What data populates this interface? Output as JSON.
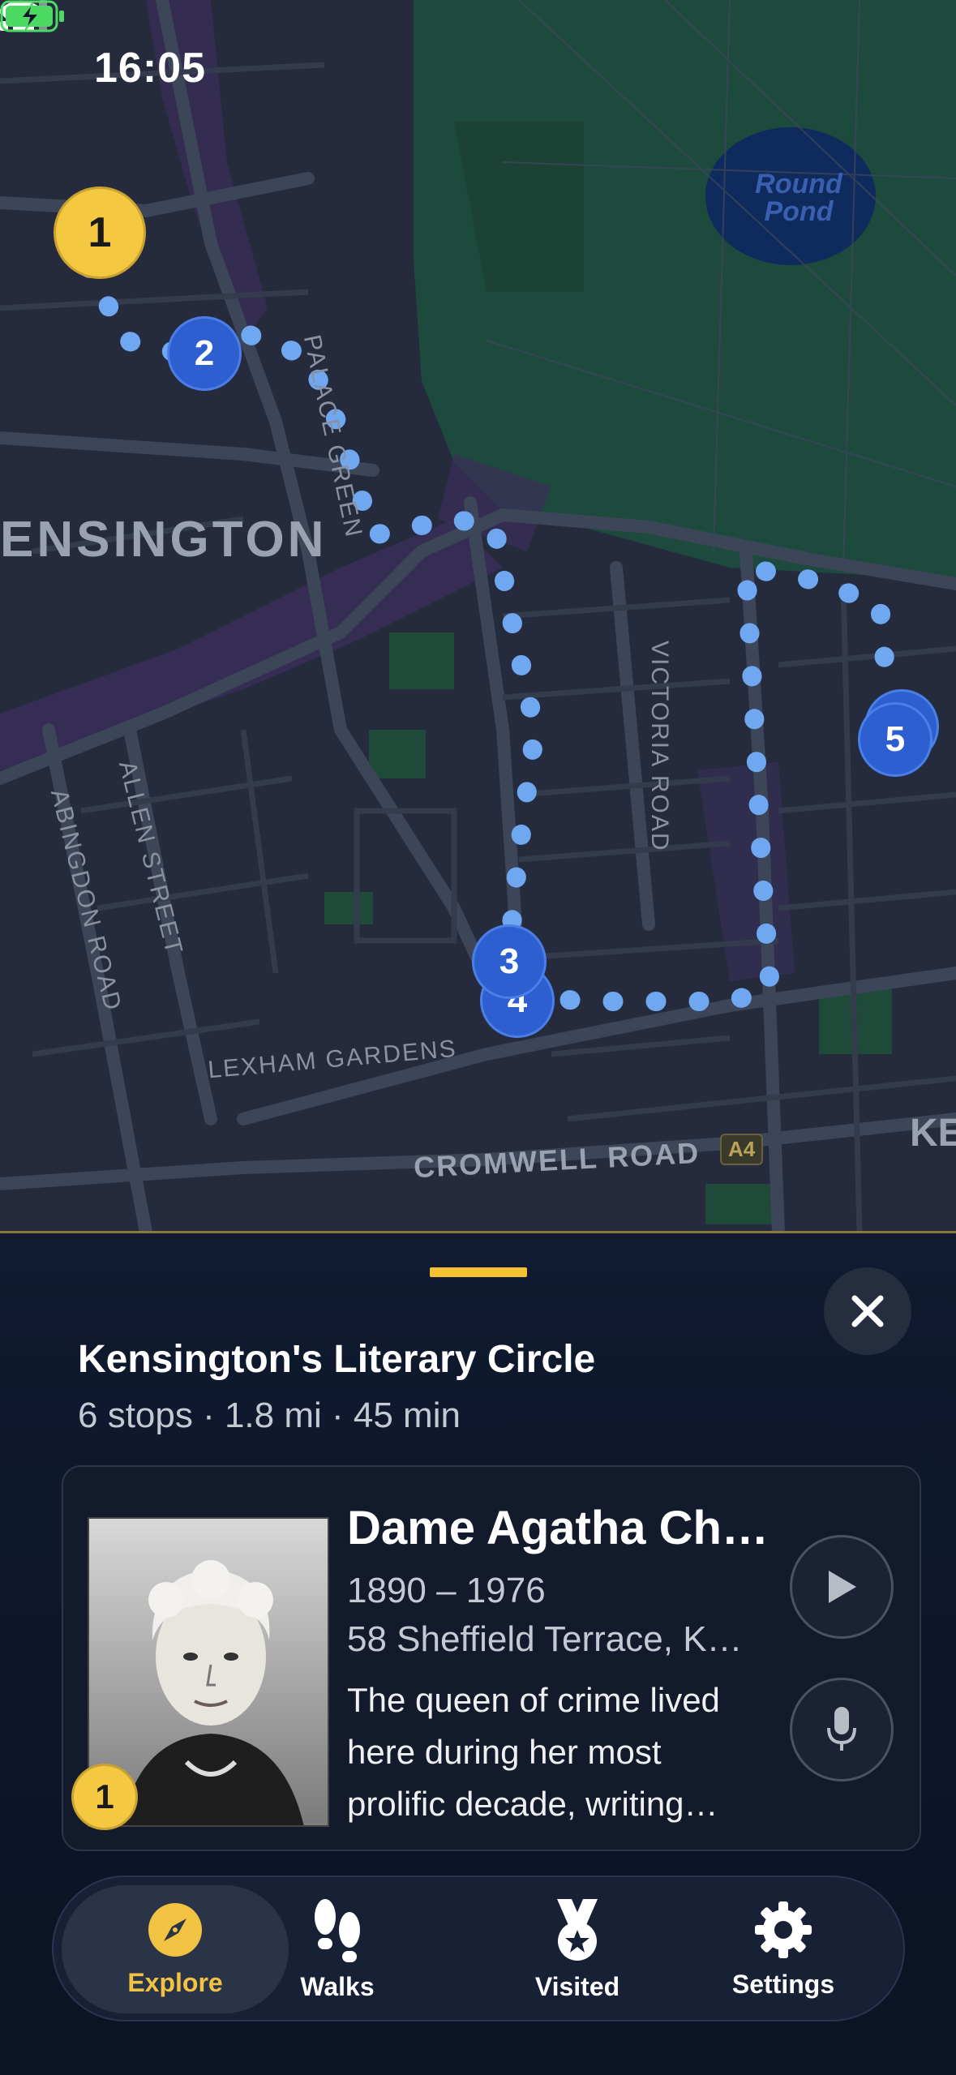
{
  "status_bar": {
    "time": "16:05"
  },
  "map": {
    "labels": {
      "area": "ENSINGTON",
      "area_right": "KE",
      "palace_green": "PALACE GREEN",
      "victoria_road": "VICTORIA ROAD",
      "allen_street": "ALLEN STREET",
      "abingdon_road": "ABINGDON ROAD",
      "lexham_gardens": "LEXHAM GARDENS",
      "cromwell_road": "CROMWELL ROAD",
      "road_badge": "A4",
      "pond_line1": "Round",
      "pond_line2": "Pond"
    },
    "stops": [
      "1",
      "2",
      "3",
      "4",
      "5"
    ]
  },
  "sheet": {
    "title": "Kensington's Literary Circle",
    "meta": "6 stops · 1.8 mi · 45 min",
    "card": {
      "name": "Dame Agatha Ch…",
      "years": "1890 – 1976",
      "address": "58 Sheffield Terrace, K…",
      "description": "The queen of crime lived here during her most prolific decade, writing…",
      "badge": "1"
    }
  },
  "tabs": [
    {
      "label": "Explore",
      "icon": "compass-icon"
    },
    {
      "label": "Walks",
      "icon": "footprints-icon"
    },
    {
      "label": "Visited",
      "icon": "medal-icon"
    },
    {
      "label": "Settings",
      "icon": "gear-icon"
    }
  ],
  "colors": {
    "accent": "#f2c242",
    "route": "#6fa8f0",
    "pin_blue": "#2d5fd0",
    "pin_yellow": "#f5c842"
  }
}
